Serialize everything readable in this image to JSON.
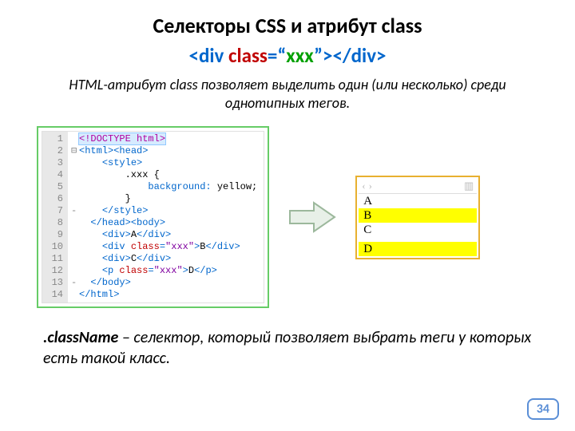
{
  "title": "Селекторы CSS и атрибут class",
  "subtitle": {
    "p1": "<div ",
    "p2": "class",
    "p3": "=“",
    "p4": "xxx",
    "p5": "”>",
    "p6": "</div>"
  },
  "intro": "HTML-атрибут class позволяет выделить один (или несколько) среди однотипных тегов.",
  "code": {
    "line_count": 14,
    "lines": {
      "l1": "<!DOCTYPE html>",
      "l2a": "<html>",
      "l2b": "<head>",
      "l3": "<style>",
      "l4": ".xxx {",
      "l5a": "background:",
      "l5b": " yellow;",
      "l6": "}",
      "l7": "</style>",
      "l8a": "</head>",
      "l8b": "<body>",
      "l9a": "<div>",
      "l9b": "A",
      "l9c": "</div>",
      "l10a": "<div ",
      "l10b": "class",
      "l10c": "=",
      "l10d": "\"xxx\"",
      "l10e": ">",
      "l10f": "B",
      "l10g": "</div>",
      "l11a": "<div>",
      "l11b": "C",
      "l11c": "</div>",
      "l12a": "<p ",
      "l12b": "class",
      "l12c": "=",
      "l12d": "\"xxx\"",
      "l12e": ">",
      "l12f": "D",
      "l12g": "</p>",
      "l13": "</body>",
      "l14": "</html>"
    }
  },
  "preview": {
    "items": [
      "A",
      "B",
      "C",
      "D"
    ],
    "highlighted": [
      false,
      true,
      false,
      true
    ]
  },
  "note": {
    "strong": ".className",
    "rest": " – селектор, который позволяет выбрать теги у которых есть такой класс."
  },
  "page": "34"
}
